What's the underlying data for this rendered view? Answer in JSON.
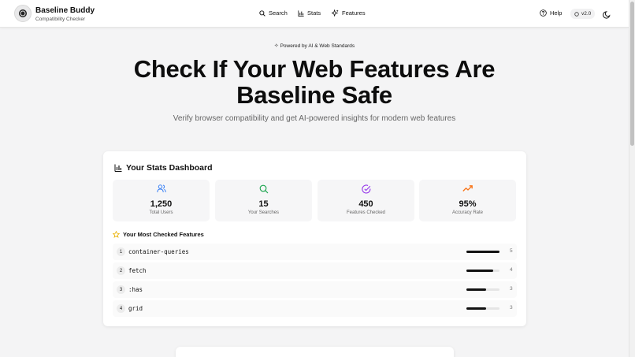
{
  "header": {
    "brand_title": "Baseline Buddy",
    "brand_subtitle": "Compatibility Checker",
    "nav": [
      {
        "label": "Search",
        "icon": "search-icon"
      },
      {
        "label": "Stats",
        "icon": "bar-chart-icon"
      },
      {
        "label": "Features",
        "icon": "sparkles-icon"
      }
    ],
    "help_label": "Help",
    "version_label": "v2.0"
  },
  "hero": {
    "powered_label": "Powered by AI & Web Standards",
    "title_line1": "Check If Your Web Features Are",
    "title_line2": "Baseline Safe",
    "subtitle": "Verify browser compatibility and get AI-powered insights for modern web features"
  },
  "dashboard": {
    "title": "Your Stats Dashboard",
    "stats": [
      {
        "value": "1,250",
        "label": "Total Users",
        "icon": "users-icon",
        "color": "#3b82f6"
      },
      {
        "value": "15",
        "label": "Your Searches",
        "icon": "search-icon",
        "color": "#16a34a"
      },
      {
        "value": "450",
        "label": "Features Checked",
        "icon": "check-circle-icon",
        "color": "#9333ea"
      },
      {
        "value": "95%",
        "label": "Accuracy Rate",
        "icon": "trending-up-icon",
        "color": "#f97316"
      }
    ],
    "features_title": "Your Most Checked Features",
    "features": [
      {
        "rank": "1",
        "name": "container-queries",
        "count": "5",
        "fraction": 1.0
      },
      {
        "rank": "2",
        "name": "fetch",
        "count": "4",
        "fraction": 0.8
      },
      {
        "rank": "3",
        "name": ":has",
        "count": "3",
        "fraction": 0.6
      },
      {
        "rank": "4",
        "name": "grid",
        "count": "3",
        "fraction": 0.6
      }
    ]
  },
  "colors": {
    "star": "#eab308",
    "bar": "#111111"
  }
}
